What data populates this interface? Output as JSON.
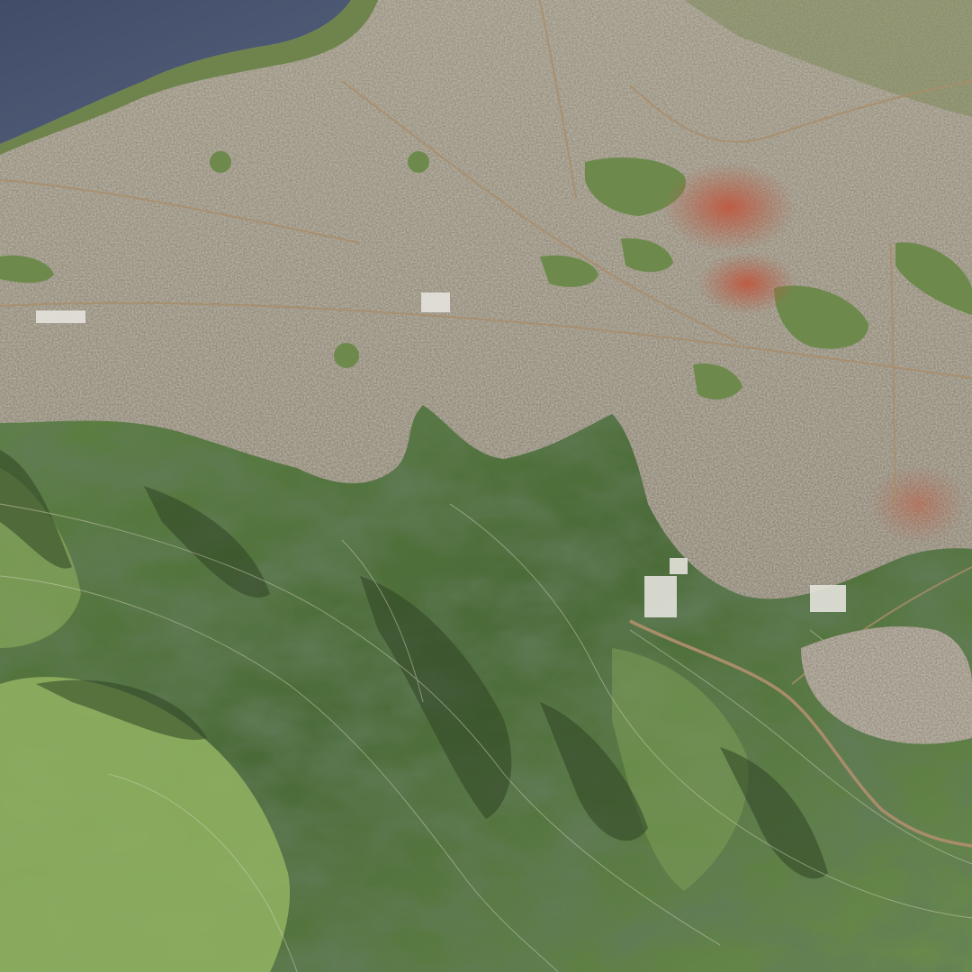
{
  "scene": {
    "kind": "3d-city-terrain-render",
    "projection": "oblique-aerial",
    "features": [
      {
        "id": "sea",
        "kind": "water-body",
        "color": "#4a5770"
      },
      {
        "id": "coastline",
        "kind": "shoreline",
        "color": "#7d8a5a"
      },
      {
        "id": "urban-area",
        "kind": "dense-city-blocks",
        "color": "#8f8777"
      },
      {
        "id": "historic-center",
        "kind": "red-roof-district",
        "color": "#b65a43"
      },
      {
        "id": "urban-parks",
        "kind": "green-space",
        "color": "#6d8a4c"
      },
      {
        "id": "mountain-range",
        "kind": "forested-terrain",
        "color": "#4f6e3b"
      },
      {
        "id": "highway",
        "kind": "major-road",
        "color": "#a98d6a"
      },
      {
        "id": "contour-lines",
        "kind": "terrain-contours",
        "color": "#c8c8b0"
      }
    ]
  },
  "colors": {
    "water": "#4a5770",
    "water_dark": "#3c4660",
    "city": "#8f8777",
    "city_light": "#b3ab9a",
    "city_dark": "#6c6558",
    "red_roofs": "#b65a43",
    "park": "#6d8a4c",
    "mountain_light": "#8fb061",
    "mountain_mid": "#5f8242",
    "mountain_dark": "#2f4424",
    "road": "#a98d6a",
    "contour": "#d2d0b8"
  }
}
